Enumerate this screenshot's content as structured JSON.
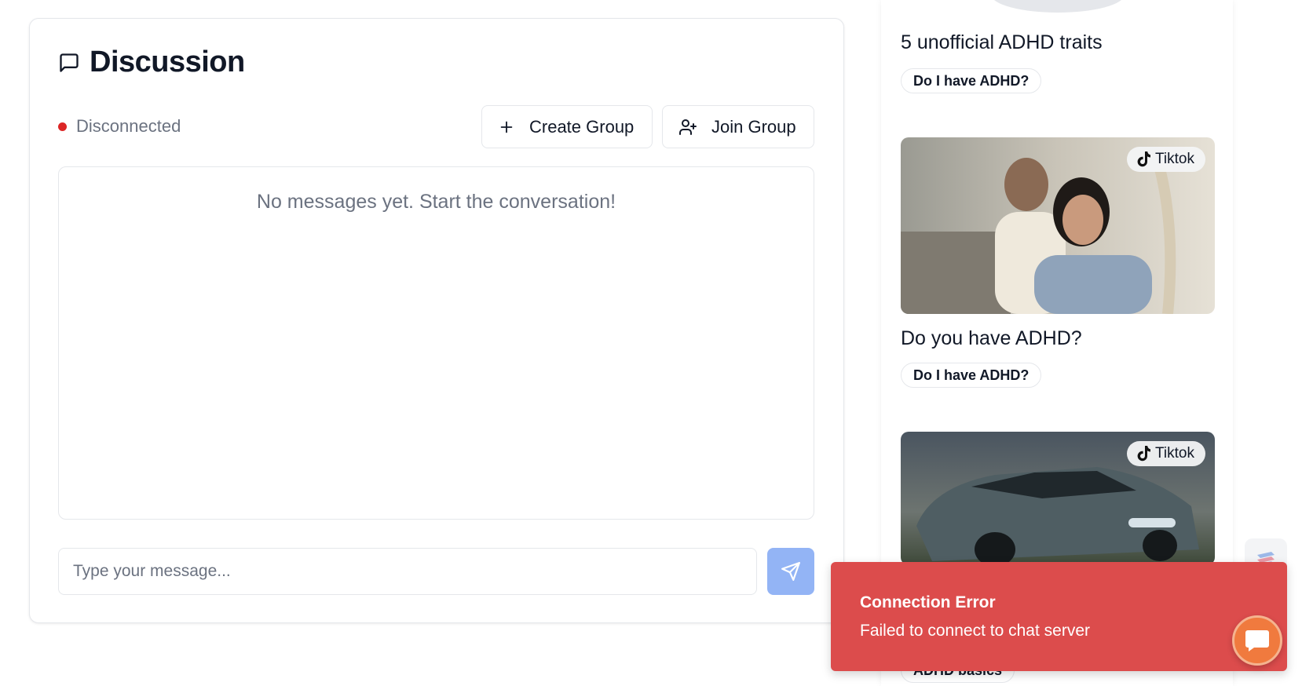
{
  "discussion": {
    "title": "Discussion",
    "status": "Disconnected",
    "create_group_label": "Create Group",
    "join_group_label": "Join Group",
    "empty_message": "No messages yet. Start the conversation!",
    "input_placeholder": "Type your message..."
  },
  "feed": {
    "items": [
      {
        "title": "5 unofficial ADHD traits",
        "tag": "Do I have ADHD?"
      },
      {
        "title": "Do you have ADHD?",
        "tag": "Do I have ADHD?",
        "source": "Tiktok"
      },
      {
        "title": "",
        "tag": "ADHD basics",
        "source": "Tiktok"
      }
    ]
  },
  "toast": {
    "title": "Connection Error",
    "description": "Failed to connect to chat server"
  },
  "icons": [
    "message-square-icon",
    "plus-icon",
    "user-plus-icon",
    "send-icon",
    "tiktok-icon",
    "chat-bubble-icon"
  ],
  "colors": {
    "error": "#dc4c4c",
    "send_button": "#93b4f5",
    "status_dot": "#dc2626",
    "chat_fab": "#f07a3e"
  }
}
